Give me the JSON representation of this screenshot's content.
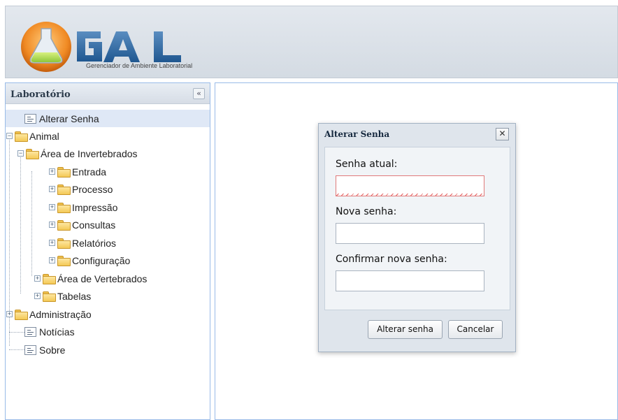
{
  "header": {
    "logo_text": "GAL",
    "logo_tagline": "Gerenciador de Ambiente Laboratorial"
  },
  "sidebar": {
    "title": "Laboratório",
    "collapse_icon": "double-chevron-left-icon",
    "items": [
      {
        "label": "Alterar Senha",
        "icon": "document-icon",
        "selected": true
      },
      {
        "label": "Animal",
        "icon": "folder-icon",
        "expanded": true
      },
      {
        "label": "Área de Invertebrados",
        "icon": "folder-icon",
        "expanded": true
      },
      {
        "label": "Entrada",
        "icon": "folder-icon",
        "expanded": false
      },
      {
        "label": "Processo",
        "icon": "folder-icon",
        "expanded": false
      },
      {
        "label": "Impressão",
        "icon": "folder-icon",
        "expanded": false
      },
      {
        "label": "Consultas",
        "icon": "folder-icon",
        "expanded": false
      },
      {
        "label": "Relatórios",
        "icon": "folder-icon",
        "expanded": false
      },
      {
        "label": "Configuração",
        "icon": "folder-icon",
        "expanded": false
      },
      {
        "label": "Área de Vertebrados",
        "icon": "folder-icon",
        "expanded": false
      },
      {
        "label": "Tabelas",
        "icon": "folder-icon",
        "expanded": false
      },
      {
        "label": "Administração",
        "icon": "folder-icon",
        "expanded": false
      },
      {
        "label": "Notícias",
        "icon": "document-icon"
      },
      {
        "label": "Sobre",
        "icon": "document-icon"
      }
    ]
  },
  "dialog": {
    "title": "Alterar Senha",
    "fields": [
      {
        "label": "Senha atual:",
        "value": "",
        "invalid": true
      },
      {
        "label": "Nova senha:",
        "value": ""
      },
      {
        "label": "Confirmar nova senha:",
        "value": ""
      }
    ],
    "buttons": {
      "submit": "Alterar senha",
      "cancel": "Cancelar"
    }
  },
  "colors": {
    "accent": "#99bbe8",
    "selection": "#dfe8f6",
    "invalid": "#e07a7a"
  }
}
